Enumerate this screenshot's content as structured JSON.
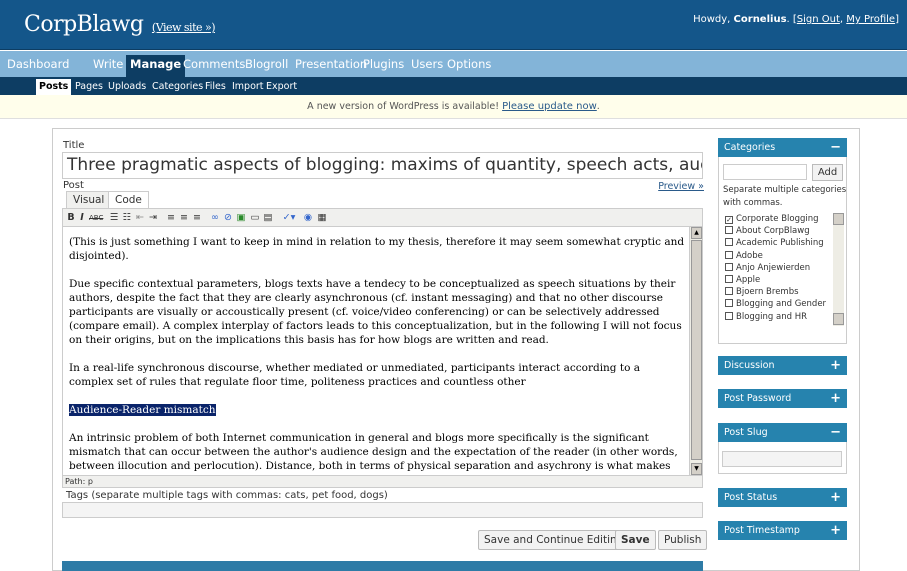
{
  "header": {
    "blog_title": "CorpBlawg",
    "view_site": "(View site »)",
    "howdy_prefix": "Howdy, ",
    "user": "Cornelius",
    "sign_out_sep1": ". [",
    "sign_out": "Sign Out",
    "sign_out_sep2": ", ",
    "my_profile": "My Profile",
    "sign_out_sep3": "]"
  },
  "adminmenu": [
    "Dashboard",
    "Write",
    "Manage",
    "Comments",
    "Blogroll",
    "Presentation",
    "Plugins",
    "Users",
    "Options"
  ],
  "submenu": [
    "Posts",
    "Pages",
    "Uploads",
    "Categories",
    "Files",
    "Import",
    "Export"
  ],
  "update_nag": {
    "text": "A new version of WordPress is available! ",
    "link": "Please update now",
    "end": "."
  },
  "post": {
    "title_label": "Title",
    "title": "Three pragmatic aspects of blogging: maxims of quantity, speech acts, audience",
    "post_label": "Post",
    "preview": "Preview »",
    "tabs": [
      "Visual",
      "Code"
    ],
    "path": "Path: p",
    "paragraphs": [
      "(This is just something I want to keep in mind in relation to my thesis, therefore it may seem somewhat cryptic and disjointed).",
      "Due specific contextual parameters, blogs texts have a tendecy to be conceptualized as speech situations by their authors, despite the fact that they are clearly asynchronous (cf. instant messaging) and that no other discourse participants are visually or accoustically present (cf. voice/video conferencing) or can be selectively addressed (compare email). A complex interplay of factors leads to this conceptualization, but in the following I will not focus on their origins, but on the implications this basis has for how blogs are written and read.",
      "In a real-life synchronous discourse, whether mediated or unmediated, participants interact according to a complex set of rules that regulate floor time, politeness practices and countless other",
      "Audience-Reader mismatch",
      "An intrinsic problem of both Internet communication in general and blogs more specifically is the significant mismatch that can occur between the author's audience design and the expectation of the reader (in other words, between illocution and perlocution). Distance, both in terms of physical separation and asychrony is what makes this mismatch possible and it is"
    ],
    "tags_label": "Tags (separate multiple tags with commas: cats, pet food, dogs)",
    "buttons": {
      "save_continue": "Save and Continue Editing",
      "save": "Save",
      "publish": "Publish"
    }
  },
  "sidebar": {
    "categories": {
      "title": "Categories",
      "toggle": "−",
      "add": "Add",
      "hint": "Separate multiple categories with commas.",
      "items": [
        {
          "label": "Corporate Blogging",
          "checked": true
        },
        {
          "label": "About CorpBlawg",
          "checked": false
        },
        {
          "label": "Academic Publishing",
          "checked": false
        },
        {
          "label": "Adobe",
          "checked": false
        },
        {
          "label": "Anjo Anjewierden",
          "checked": false
        },
        {
          "label": "Apple",
          "checked": false
        },
        {
          "label": "Bjoern Brembs",
          "checked": false
        },
        {
          "label": "Blogging and Gender",
          "checked": false
        },
        {
          "label": "Blogging and HR",
          "checked": false
        }
      ]
    },
    "discussion": {
      "title": "Discussion",
      "toggle": "+"
    },
    "password": {
      "title": "Post Password",
      "toggle": "+"
    },
    "slug": {
      "title": "Post Slug",
      "toggle": "−"
    },
    "status": {
      "title": "Post Status",
      "toggle": "+"
    },
    "timestamp": {
      "title": "Post Timestamp",
      "toggle": "+"
    }
  }
}
